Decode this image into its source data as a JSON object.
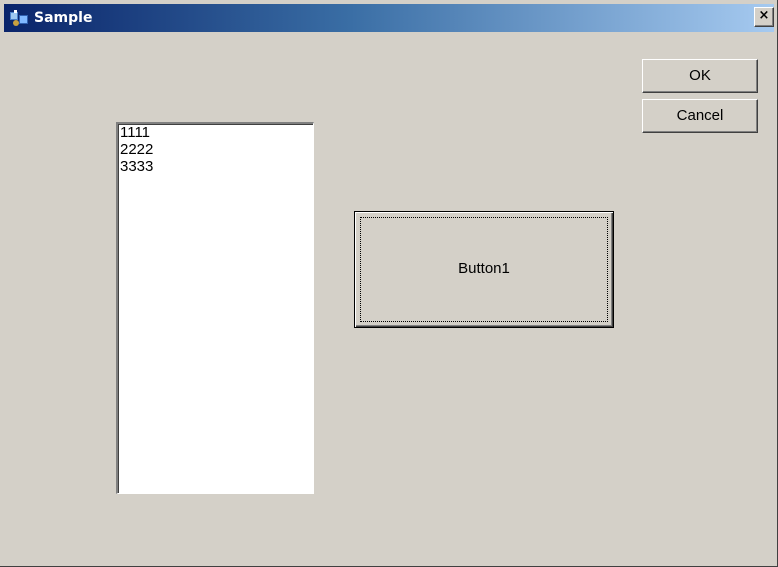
{
  "window": {
    "title": "Sample",
    "close_glyph": "×"
  },
  "icons": {
    "app": "app-icon",
    "close": "close-icon"
  },
  "buttons": {
    "ok_label": "OK",
    "cancel_label": "Cancel",
    "button1_label": "Button1"
  },
  "listbox": {
    "items": [
      "1111",
      "2222",
      "3333"
    ]
  },
  "colors": {
    "titlebar_start": "#0a246a",
    "titlebar_end": "#a6caf0",
    "face": "#d4d0c8"
  }
}
